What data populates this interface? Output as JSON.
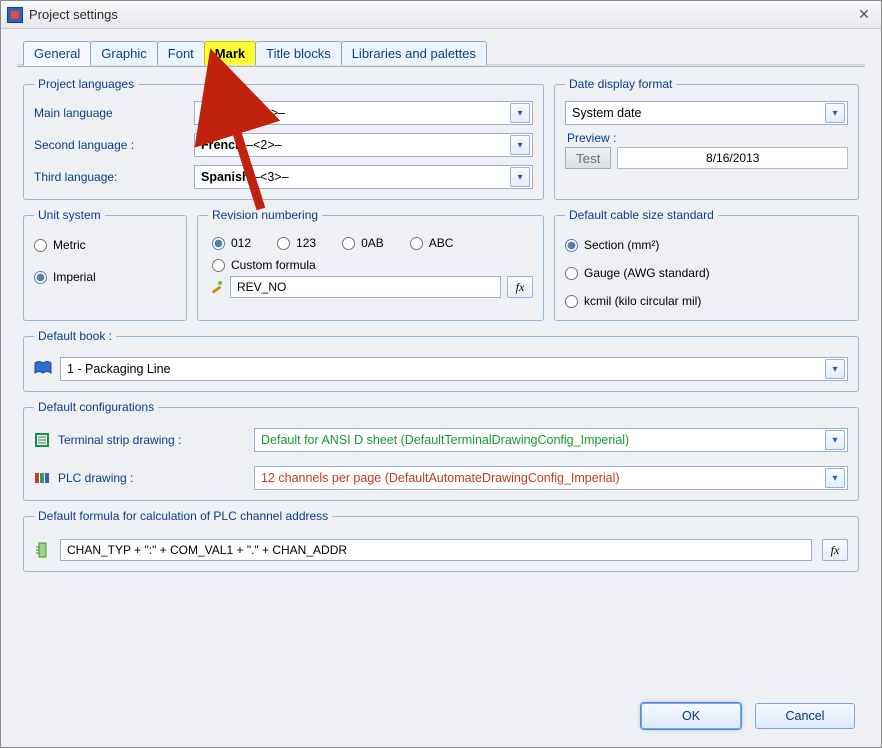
{
  "window": {
    "title": "Project settings"
  },
  "tabs": {
    "general": "General",
    "graphic": "Graphic",
    "font": "Font",
    "mark": "Mark",
    "title_blocks": "Title blocks",
    "libraries": "Libraries and palettes"
  },
  "languages": {
    "legend": "Project languages",
    "main_label": "Main language",
    "second_label": "Second language :",
    "third_label": "Third language:",
    "main_value": "English",
    "main_suffix": "  –<1>–",
    "second_value": "French",
    "second_suffix": "  –<2>–",
    "third_value": "Spanish",
    "third_suffix": "  –<3>–"
  },
  "date": {
    "legend": "Date display format",
    "value": "System date",
    "preview_label": "Preview :",
    "test_btn": "Test",
    "preview_value": "8/16/2013"
  },
  "unit": {
    "legend": "Unit system",
    "metric": "Metric",
    "imperial": "Imperial"
  },
  "revision": {
    "legend": "Revision numbering",
    "o012": "012",
    "o123": "123",
    "o0AB": "0AB",
    "oABC": "ABC",
    "custom": "Custom formula",
    "formula": "REV_NO"
  },
  "cable": {
    "legend": "Default cable size standard",
    "section": "Section (mm²)",
    "gauge": "Gauge (AWG standard)",
    "kcmil": "kcmil (kilo circular mil)"
  },
  "book": {
    "legend": "Default book :",
    "value": "1 - Packaging Line"
  },
  "config": {
    "legend": "Default configurations",
    "terminal_label": "Terminal strip drawing :",
    "terminal_value": "Default for ANSI D sheet (DefaultTerminalDrawingConfig_Imperial)",
    "plc_label": "PLC drawing :",
    "plc_value": "12 channels per page (DefaultAutomateDrawingConfig_Imperial)"
  },
  "plc_formula": {
    "legend": "Default formula for calculation of PLC channel address",
    "value": "CHAN_TYP + \":\" + COM_VAL1 + \".\" + CHAN_ADDR"
  },
  "buttons": {
    "ok": "OK",
    "cancel": "Cancel"
  },
  "fx": "fx"
}
